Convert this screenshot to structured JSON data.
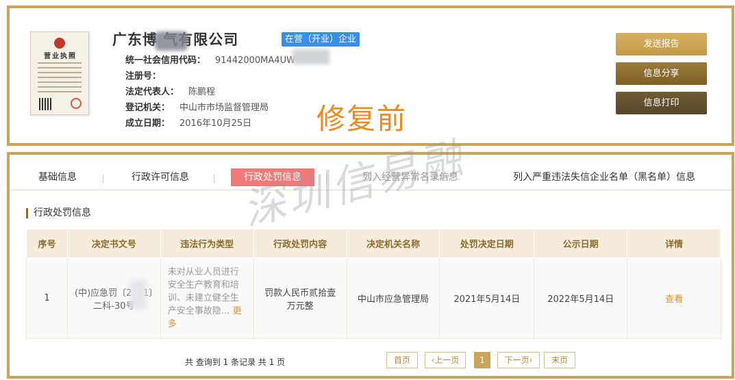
{
  "company": {
    "name": "广东博    气有限公司",
    "status": "在营（开业）企业",
    "license_title": "营业执照",
    "fields": [
      {
        "label": "统一社会信用代码：",
        "value": "91442000MA4UW"
      },
      {
        "label": "注册号：",
        "value": ""
      },
      {
        "label": "法定代表人：",
        "value": "陈鹏程"
      },
      {
        "label": "登记机关：",
        "value": "中山市市场监督管理局"
      },
      {
        "label": "成立日期：",
        "value": "2016年10月25日"
      }
    ]
  },
  "watermark": {
    "before": "修复前",
    "diagonal": "深圳信易融"
  },
  "actions": {
    "report": "发送报告",
    "share": "信息分享",
    "print": "信息打印"
  },
  "tabs": [
    "基础信息",
    "行政许可信息",
    "行政处罚信息",
    "列入经营异常名录信息",
    "列入严重违法失信企业名单（黑名单）信息"
  ],
  "section": {
    "title": "行政处罚信息"
  },
  "table": {
    "headers": [
      "序号",
      "决定书文号",
      "违法行为类型",
      "行政处罚内容",
      "决定机关名称",
      "处罚决定日期",
      "公示日期",
      "详情"
    ],
    "rows": [
      {
        "no": "1",
        "doc_no": "(中)应急罚〔2  2  1〕二科-30号",
        "violation": "未对从业人员进行安全生产教育和培训、未建立健全生产安全事故隐...",
        "more": "更多",
        "penalty": "罚款人民币贰拾壹万元整",
        "authority": "中山市应急管理局",
        "decision_date": "2021年5月14日",
        "publish_date": "2022年5月14日",
        "detail": "查看"
      }
    ]
  },
  "pagination": {
    "summary": "共 查询到 1 条记录 共 1 页",
    "first": "首页",
    "prev": "‹上一页",
    "current": "1",
    "next": "下一页›",
    "last": "末页"
  },
  "colors": {
    "gold": "#c9a45a",
    "badge": "#3a8ee6",
    "active_tab": "#ee7a7a",
    "link": "#e0902e"
  }
}
